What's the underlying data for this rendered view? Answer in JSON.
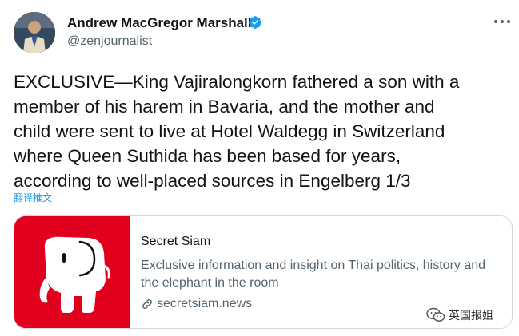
{
  "author": {
    "name": "Andrew MacGregor Marshall",
    "handle": "@zenjournalist",
    "verified": true
  },
  "tweet": {
    "text_lines": [
      "EXCLUSIVE—King Vajiralongkorn fathered a son with a",
      "member of his harem in Bavaria, and the mother and",
      "child were sent to live at Hotel Waldegg in Switzerland",
      "where Queen Suthida has been based for years,",
      "according to well-placed sources in Engelberg 1/3"
    ],
    "translate_label": "翻译推文"
  },
  "card": {
    "title": "Secret Siam",
    "description_lines": [
      "Exclusive information and insight on Thai politics, history and",
      "the elephant in the room"
    ],
    "domain": "secretsiam.news",
    "thumb_color": "#e1001e"
  },
  "watermark": {
    "text": "英国报姐"
  },
  "colors": {
    "accent": "#1d9bf0",
    "text": "#0f1419",
    "secondary": "#536471"
  }
}
